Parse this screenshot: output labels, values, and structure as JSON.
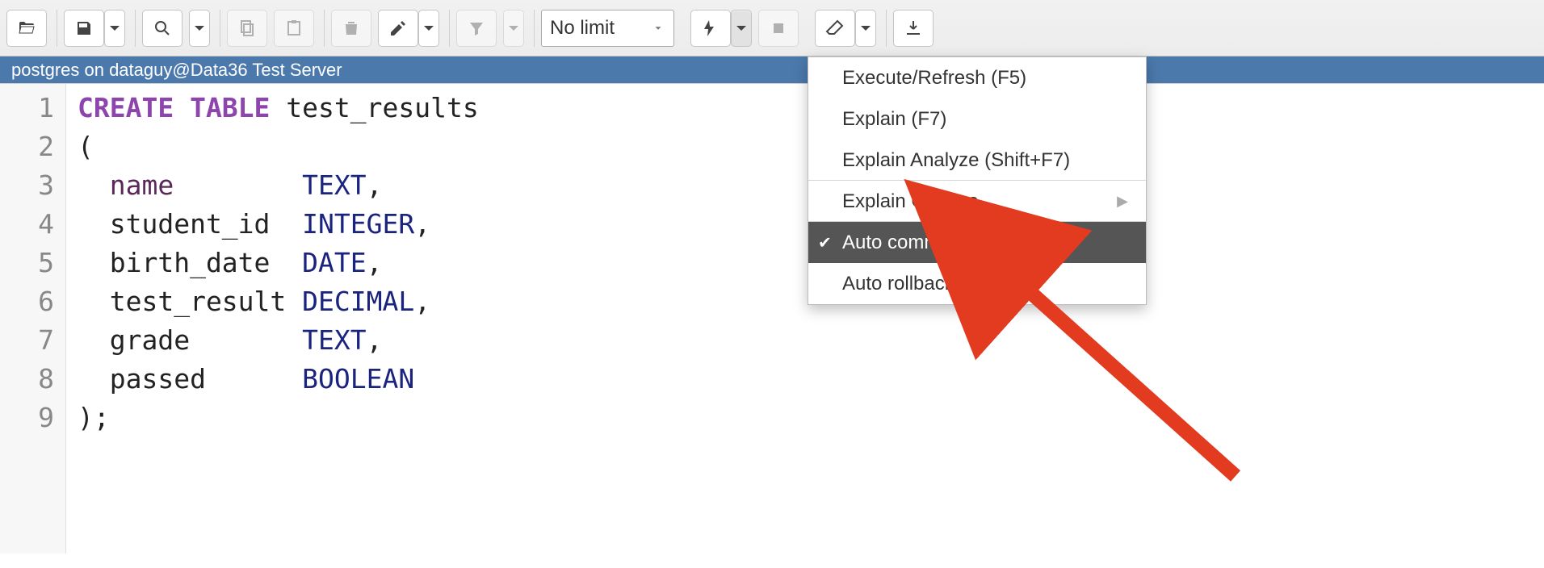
{
  "toolbar": {
    "limit_label": "No limit"
  },
  "connection": {
    "text": "postgres on dataguy@Data36 Test Server"
  },
  "menu": {
    "items": [
      {
        "label": "Execute/Refresh (F5)",
        "checked": false,
        "highlight": false,
        "submenu": false
      },
      {
        "label": "Explain (F7)",
        "checked": false,
        "highlight": false,
        "submenu": false
      },
      {
        "label": "Explain Analyze (Shift+F7)",
        "checked": false,
        "highlight": false,
        "submenu": false,
        "sepAfter": true
      },
      {
        "label": "Explain Options",
        "checked": false,
        "highlight": false,
        "submenu": true,
        "sepAfter": true
      },
      {
        "label": "Auto commit?",
        "checked": true,
        "highlight": true,
        "submenu": false
      },
      {
        "label": "Auto rollback?",
        "checked": false,
        "highlight": false,
        "submenu": false
      }
    ]
  },
  "code": {
    "lines": [
      {
        "n": "1",
        "segments": [
          {
            "t": "CREATE TABLE ",
            "c": "kw"
          },
          {
            "t": "test_results",
            "c": "ident"
          }
        ]
      },
      {
        "n": "2",
        "segments": [
          {
            "t": "(",
            "c": "punct"
          }
        ]
      },
      {
        "n": "3",
        "segments": [
          {
            "t": "  name        ",
            "c": "colname"
          },
          {
            "t": "TEXT",
            "c": "dtype"
          },
          {
            "t": ",",
            "c": "punct"
          }
        ]
      },
      {
        "n": "4",
        "segments": [
          {
            "t": "  student_id  ",
            "c": "ident"
          },
          {
            "t": "INTEGER",
            "c": "dtype"
          },
          {
            "t": ",",
            "c": "punct"
          }
        ]
      },
      {
        "n": "5",
        "segments": [
          {
            "t": "  birth_date  ",
            "c": "ident"
          },
          {
            "t": "DATE",
            "c": "dtype"
          },
          {
            "t": ",",
            "c": "punct"
          }
        ]
      },
      {
        "n": "6",
        "segments": [
          {
            "t": "  test_result ",
            "c": "ident"
          },
          {
            "t": "DECIMAL",
            "c": "dtype"
          },
          {
            "t": ",",
            "c": "punct"
          }
        ]
      },
      {
        "n": "7",
        "segments": [
          {
            "t": "  grade       ",
            "c": "ident"
          },
          {
            "t": "TEXT",
            "c": "dtype"
          },
          {
            "t": ",",
            "c": "punct"
          }
        ]
      },
      {
        "n": "8",
        "segments": [
          {
            "t": "  passed      ",
            "c": "ident"
          },
          {
            "t": "BOOLEAN",
            "c": "dtype"
          }
        ]
      },
      {
        "n": "9",
        "segments": [
          {
            "t": ");",
            "c": "punct"
          }
        ]
      }
    ]
  }
}
